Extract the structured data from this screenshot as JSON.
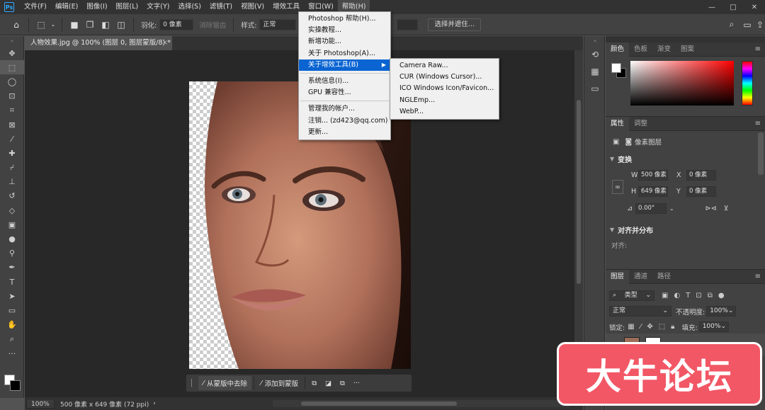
{
  "menubar": {
    "logo": "Ps",
    "items": [
      "文件(F)",
      "编辑(E)",
      "图像(I)",
      "图层(L)",
      "文字(Y)",
      "选择(S)",
      "滤镜(T)",
      "视图(V)",
      "增效工具",
      "窗口(W)",
      "帮助(H)"
    ],
    "window_controls": [
      "—",
      "□",
      "✕"
    ]
  },
  "options_bar": {
    "feather_label": "羽化:",
    "feather_value": "0 像素",
    "antialias_label": "消除锯齿",
    "style_label": "样式:",
    "style_value": "正常",
    "select_mask_button": "选择并遮住..."
  },
  "document": {
    "tab_title": "人物效果.jpg @ 100% (图层 0, 图层蒙版/8) *",
    "close": "×"
  },
  "taskbar": {
    "remove_label": "从蒙版中去除",
    "add_label": "添加到蒙版",
    "more": "···"
  },
  "statusbar": {
    "zoom": "100%",
    "doc_info": "500 像素 x 649 像素 (72 ppi)",
    "arrow": "›"
  },
  "help_menu": {
    "items": [
      {
        "label": "Photoshop 帮助(H)..."
      },
      {
        "label": "实操教程..."
      },
      {
        "label": "新增功能..."
      },
      {
        "label": "关于 Photoshop(A)..."
      },
      {
        "label": "关于增效工具(B)"
      },
      {
        "label": "系统信息(I)..."
      },
      {
        "label": "GPU 兼容性..."
      },
      {
        "label": "管理我的帐户..."
      },
      {
        "label": "注销... (zd423@qq.com)"
      },
      {
        "label": "更新..."
      }
    ]
  },
  "plugins_submenu": {
    "items": [
      "Camera Raw...",
      "CUR (Windows Cursor)...",
      "ICO Windows Icon/Favicon...",
      "NGLEmp...",
      "WebP..."
    ]
  },
  "color_panel": {
    "tabs": [
      "颜色",
      "色板",
      "渐变",
      "图案"
    ]
  },
  "properties_panel": {
    "tabs": [
      "属性",
      "调整"
    ],
    "layer_type": "像素图层",
    "transform_title": "变换",
    "w_label": "W",
    "w_value": "500 像素",
    "h_label": "H",
    "h_value": "649 像素",
    "x_label": "X",
    "x_value": "0 像素",
    "y_label": "Y",
    "y_value": "0 像素",
    "angle_value": "0.00°",
    "align_title": "对齐并分布",
    "align_label": "对齐:"
  },
  "layers_panel": {
    "tabs": [
      "图层",
      "通道",
      "路径"
    ],
    "filter_label": "类型",
    "blend_mode": "正常",
    "opacity_label": "不透明度:",
    "opacity_value": "100%",
    "lock_label": "锁定:",
    "fill_label": "填充:",
    "fill_value": "100%"
  },
  "watermark": {
    "text": "大牛论坛"
  }
}
